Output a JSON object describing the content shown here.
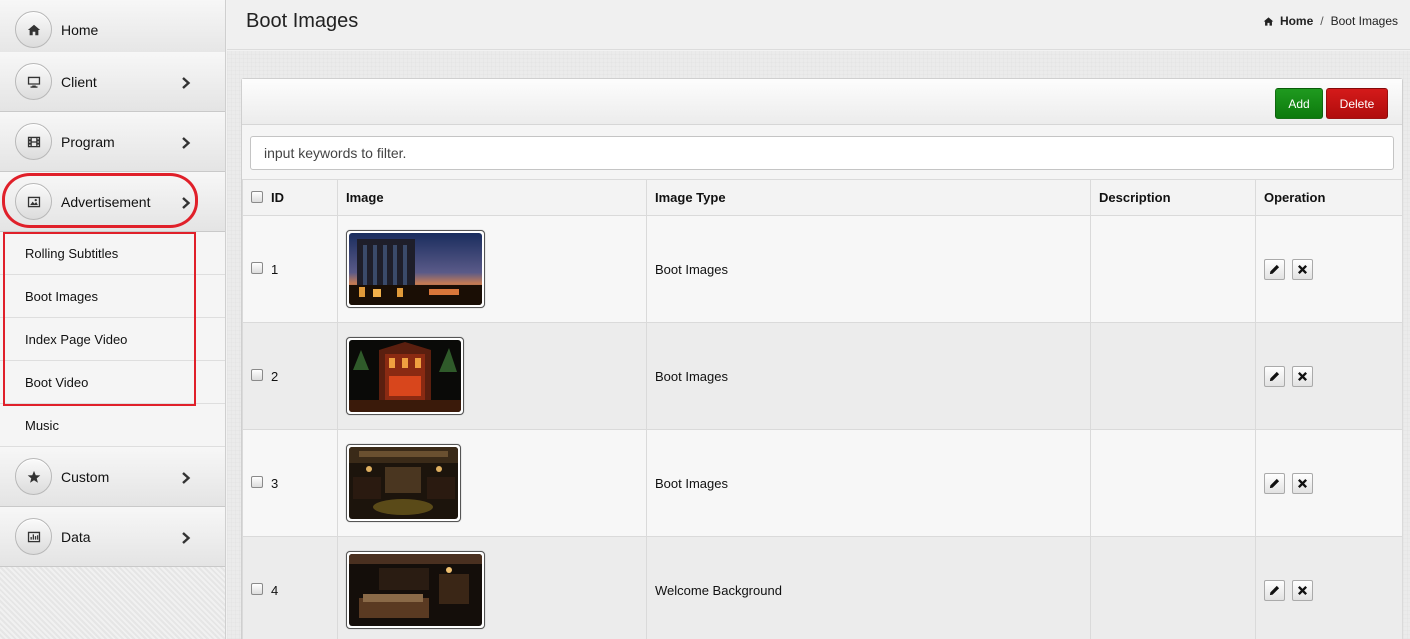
{
  "sidebar": {
    "items": [
      {
        "label": "Home",
        "icon": "home-icon",
        "has_submenu": false
      },
      {
        "label": "Client",
        "icon": "monitor-icon",
        "has_submenu": true
      },
      {
        "label": "Program",
        "icon": "film-icon",
        "has_submenu": true
      },
      {
        "label": "Advertisement",
        "icon": "image-icon",
        "has_submenu": true,
        "expanded": true
      },
      {
        "label": "Custom",
        "icon": "star-icon",
        "has_submenu": true
      },
      {
        "label": "Data",
        "icon": "bar-chart-icon",
        "has_submenu": true
      }
    ],
    "submenu": [
      {
        "label": "Rolling Subtitles"
      },
      {
        "label": "Boot Images"
      },
      {
        "label": "Index Page Video"
      },
      {
        "label": "Boot Video"
      },
      {
        "label": "Music"
      }
    ]
  },
  "header": {
    "title": "Boot Images",
    "breadcrumb": {
      "home": "Home",
      "separator": "/",
      "current": "Boot Images"
    }
  },
  "toolbar": {
    "add_label": "Add",
    "delete_label": "Delete"
  },
  "filter": {
    "placeholder": "input keywords to filter."
  },
  "table": {
    "columns": [
      "ID",
      "Image",
      "Image Type",
      "Description",
      "Operation"
    ],
    "rows": [
      {
        "id": "1",
        "image_type": "Boot Images",
        "description": ""
      },
      {
        "id": "2",
        "image_type": "Boot Images",
        "description": ""
      },
      {
        "id": "3",
        "image_type": "Boot Images",
        "description": ""
      },
      {
        "id": "4",
        "image_type": "Welcome Background",
        "description": ""
      }
    ]
  },
  "colors": {
    "add_button": "#158a15",
    "delete_button": "#c41313",
    "highlight": "#e0202a"
  }
}
